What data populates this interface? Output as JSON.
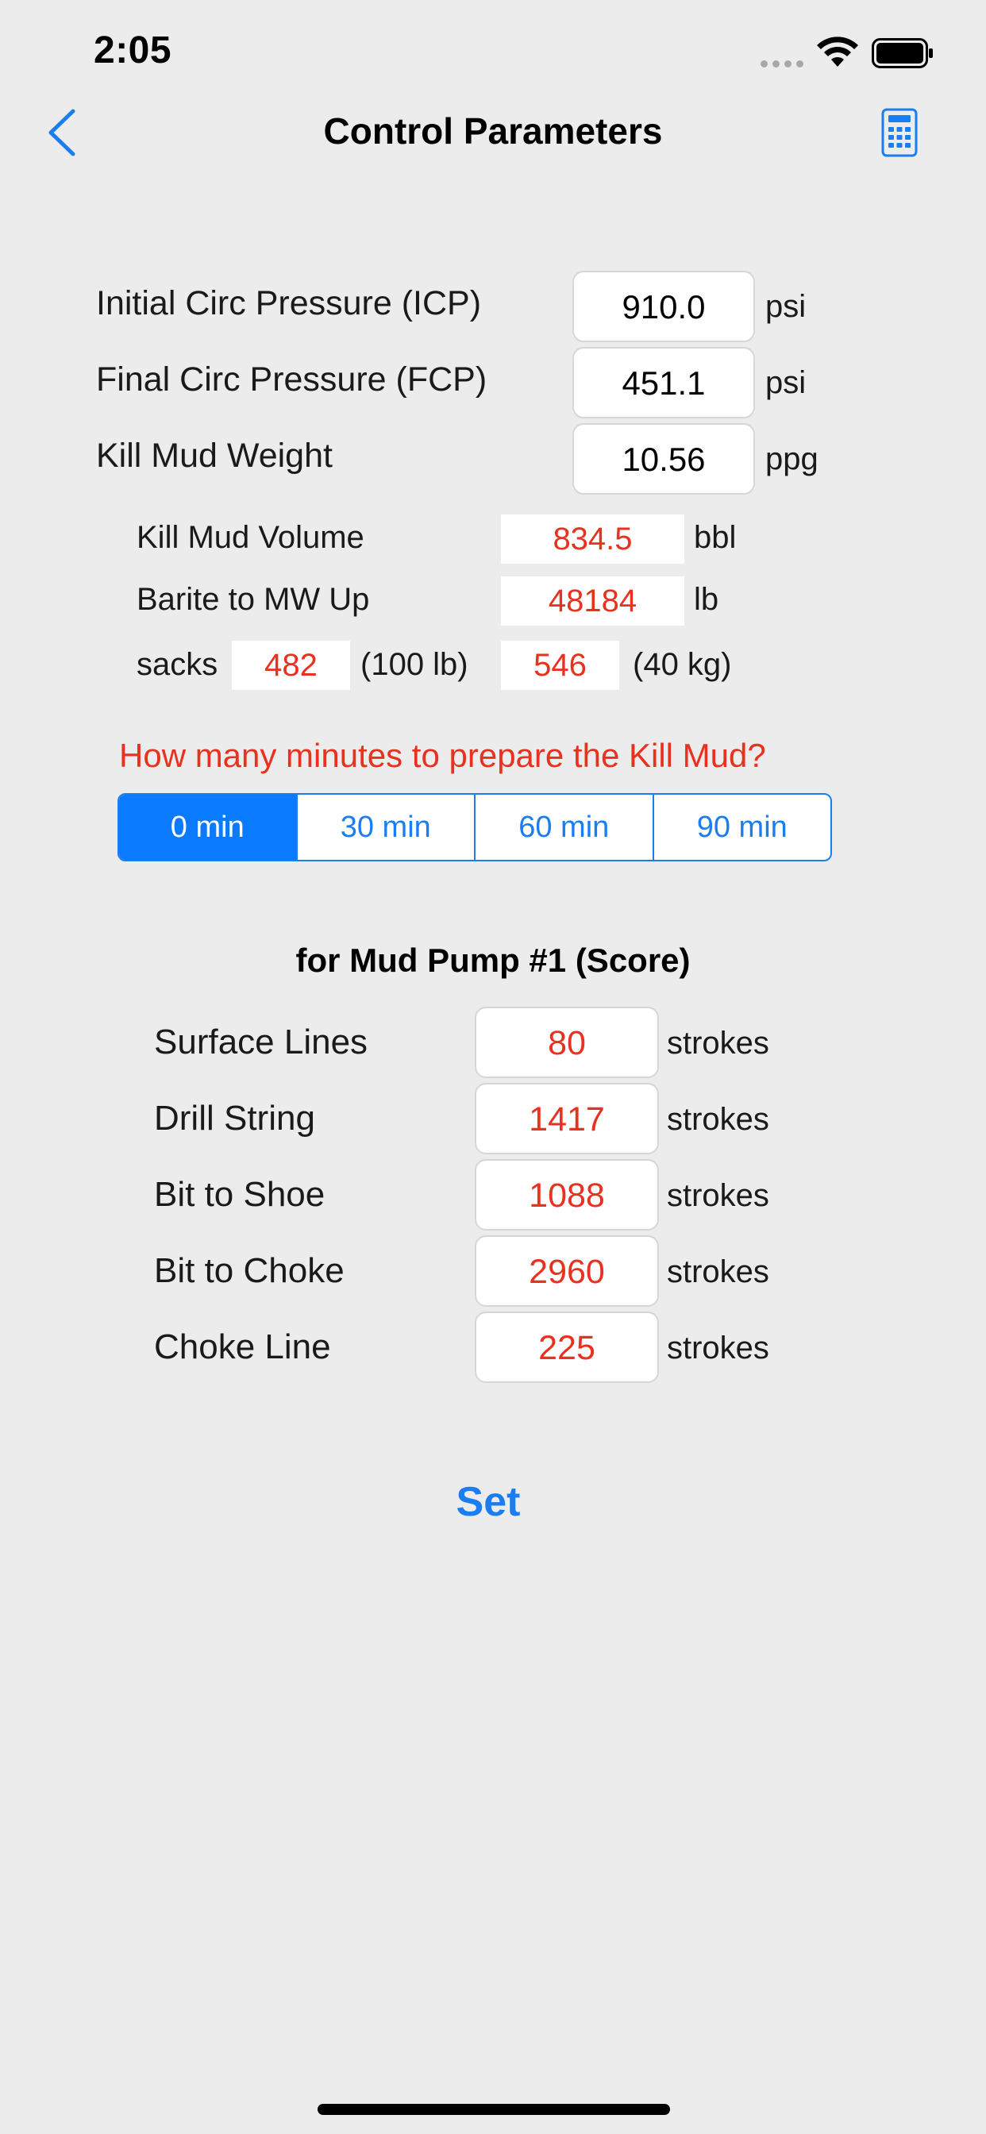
{
  "status_bar": {
    "time": "2:05"
  },
  "nav": {
    "title": "Control Parameters"
  },
  "params": [
    {
      "label": "Initial Circ Pressure (ICP)",
      "value": "910.0",
      "unit": "psi"
    },
    {
      "label": "Final Circ Pressure (FCP)",
      "value": "451.1",
      "unit": "psi"
    },
    {
      "label": "Kill Mud Weight",
      "value": "10.56",
      "unit": "ppg"
    }
  ],
  "kill_mud": {
    "volume_label": "Kill Mud Volume",
    "volume_value": "834.5",
    "volume_unit": "bbl",
    "barite_label": "Barite to MW Up",
    "barite_value": "48184",
    "barite_unit": "lb",
    "sacks_label": "sacks",
    "sacks_100_value": "482",
    "sacks_100_unit": "(100 lb)",
    "sacks_40_value": "546",
    "sacks_40_unit": "(40 kg)"
  },
  "prep": {
    "question": "How many minutes to prepare the Kill Mud?",
    "options": [
      "0 min",
      "30 min",
      "60 min",
      "90 min"
    ],
    "selected": "0 min"
  },
  "pump": {
    "title": "for Mud Pump #1 (Score)",
    "rows": [
      {
        "label": "Surface Lines",
        "value": "80",
        "unit": "strokes"
      },
      {
        "label": "Drill String",
        "value": "1417",
        "unit": "strokes"
      },
      {
        "label": "Bit to Shoe",
        "value": "1088",
        "unit": "strokes"
      },
      {
        "label": "Bit to Choke",
        "value": "2960",
        "unit": "strokes"
      },
      {
        "label": "Choke Line",
        "value": "225",
        "unit": "strokes"
      }
    ]
  },
  "actions": {
    "set_label": "Set"
  },
  "icons": {
    "back": "chevron-left-icon",
    "calculator": "calculator-icon",
    "wifi": "wifi-icon",
    "battery": "battery-icon",
    "signal": "signal-icon"
  },
  "colors": {
    "accent": "#0a7aff",
    "value_red": "#e8311e",
    "background": "#ececec"
  }
}
